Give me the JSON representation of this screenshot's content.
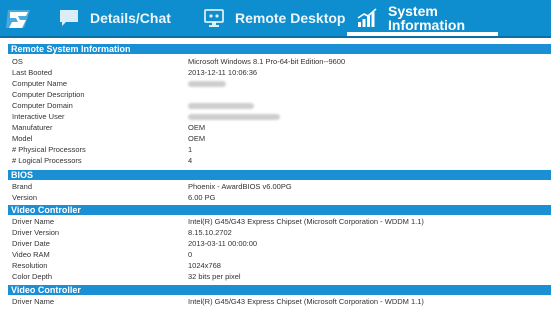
{
  "topbar": {
    "accent_color": "#0e8ecf",
    "logo_icon": "app-logo-icon",
    "tabs": [
      {
        "label": "Details/Chat",
        "icon": "chat-bubble-icon"
      },
      {
        "label": "Remote Desktop",
        "icon": "remote-desktop-icon"
      },
      {
        "label": "System Information",
        "label_line1": "System",
        "label_line2": "Information",
        "icon": "bar-chart-icon",
        "selected": true
      }
    ]
  },
  "sections": [
    {
      "title": "Remote System Information",
      "rows": [
        {
          "key": "OS",
          "value": "Microsoft Windows 8.1 Pro-64-bit Edition--9600"
        },
        {
          "key": "Last Booted",
          "value": "2013-12-11 10:06:36"
        },
        {
          "key": "Computer Name",
          "value": ""
        },
        {
          "key": "Computer Description",
          "value": ""
        },
        {
          "key": "Computer Domain",
          "value": ""
        },
        {
          "key": "Interactive User",
          "value": ""
        },
        {
          "key": "Manufaturer",
          "value": "OEM"
        },
        {
          "key": "Model",
          "value": "OEM"
        },
        {
          "key": "# Physical Processors",
          "value": "1"
        },
        {
          "key": "# Logical Processors",
          "value": "4"
        }
      ]
    },
    {
      "title": "BIOS",
      "rows": [
        {
          "key": "Brand",
          "value": "Phoenix - AwardBIOS v6.00PG"
        },
        {
          "key": "Version",
          "value": "6.00 PG"
        }
      ]
    },
    {
      "title": "Video Controller",
      "rows": [
        {
          "key": "Driver Name",
          "value": "Intel(R) G45/G43 Express Chipset (Microsoft Corporation - WDDM 1.1)"
        },
        {
          "key": "Driver Version",
          "value": "8.15.10.2702"
        },
        {
          "key": "Driver Date",
          "value": "2013-03-11 00:00:00"
        },
        {
          "key": "Video RAM",
          "value": "0"
        },
        {
          "key": "Resolution",
          "value": "1024x768"
        },
        {
          "key": "Color Depth",
          "value": "32 bits per pixel"
        }
      ]
    },
    {
      "title": "Video Controller",
      "rows": [
        {
          "key": "Driver Name",
          "value": "Intel(R) G45/G43 Express Chipset (Microsoft Corporation - WDDM 1.1)"
        }
      ]
    }
  ]
}
